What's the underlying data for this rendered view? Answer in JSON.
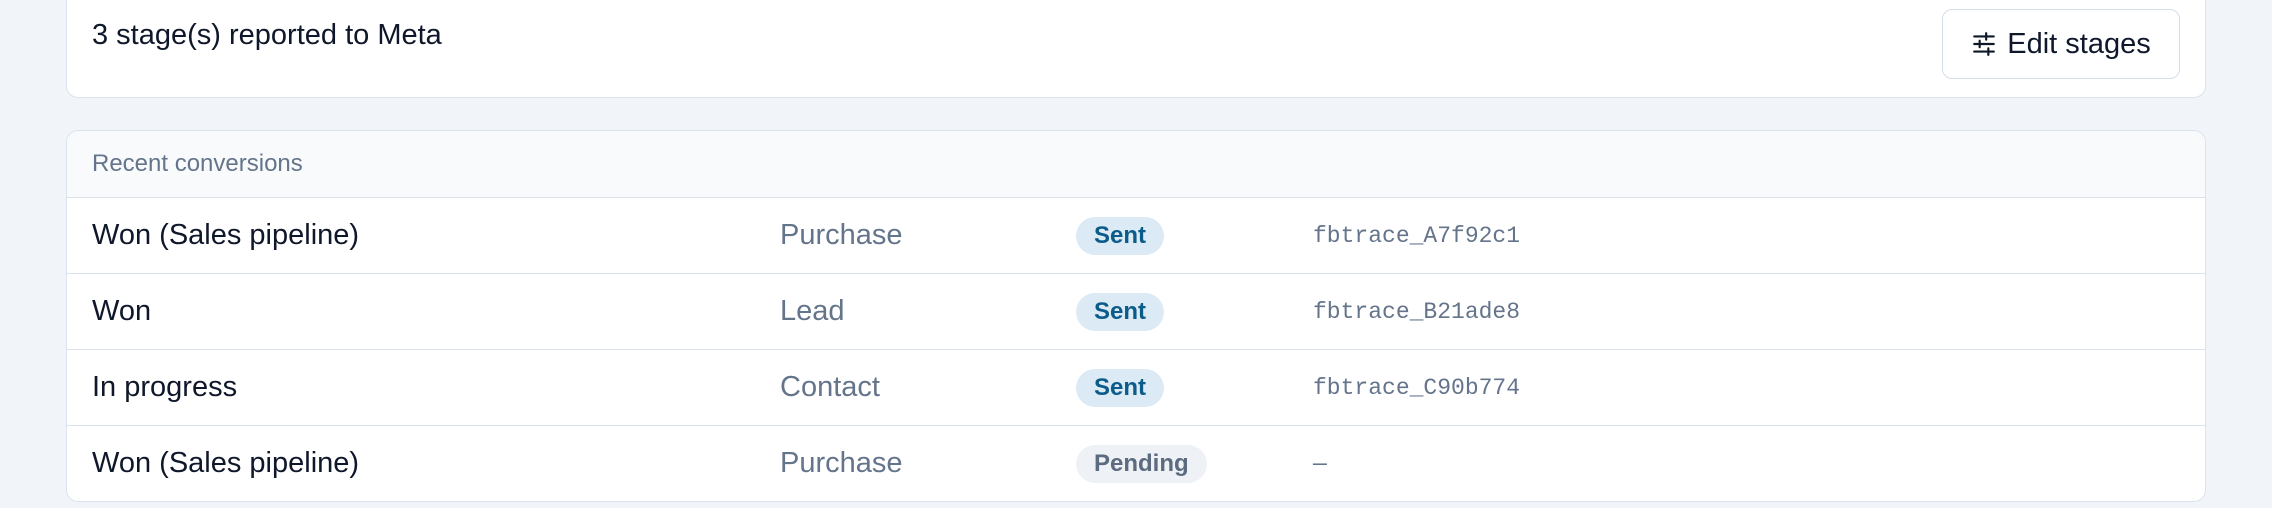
{
  "summary": {
    "text": "3 stage(s) reported to Meta",
    "edit_button_label": "Edit stages",
    "edit_button_icon": "sliders-icon"
  },
  "conversions": {
    "header": "Recent conversions",
    "rows": [
      {
        "stage": "Won (Sales pipeline)",
        "event": "Purchase",
        "status": "Sent",
        "trace": "fbtrace_A7f92c1"
      },
      {
        "stage": "Won",
        "event": "Lead",
        "status": "Sent",
        "trace": "fbtrace_B21ade8"
      },
      {
        "stage": "In progress",
        "event": "Contact",
        "status": "Sent",
        "trace": "fbtrace_C90b774"
      },
      {
        "stage": "Won (Sales pipeline)",
        "event": "Purchase",
        "status": "Pending",
        "trace": "—"
      }
    ]
  },
  "colors": {
    "sent_badge_bg": "#dbeaf5",
    "sent_badge_text": "#0b5c8a",
    "pending_badge_bg": "#eef1f5",
    "pending_badge_text": "#5c6b80"
  }
}
